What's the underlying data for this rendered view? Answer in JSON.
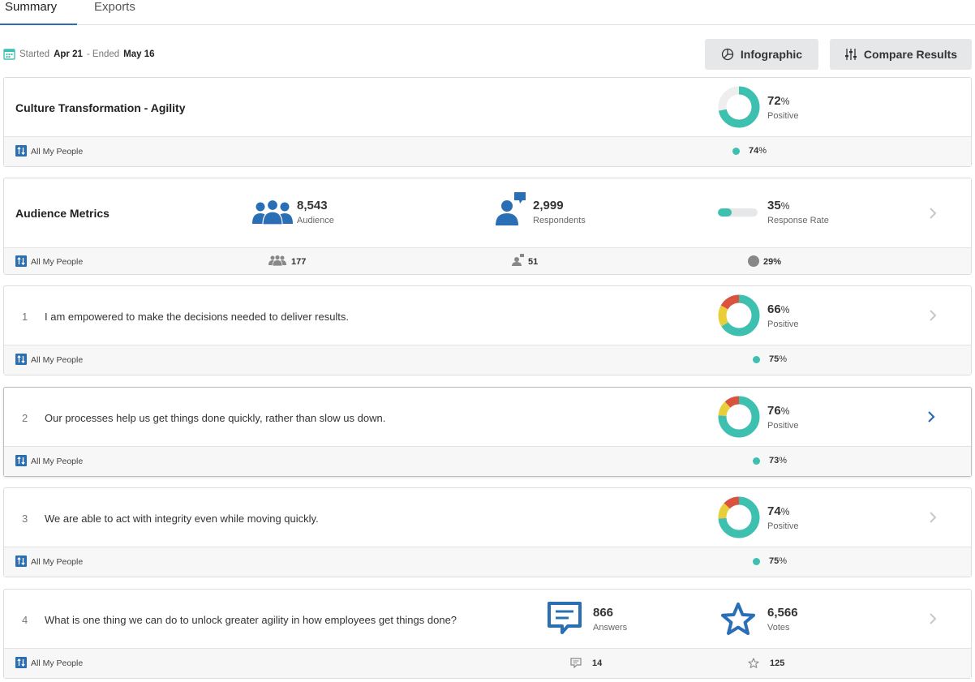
{
  "tabs": [
    {
      "label": "Summary",
      "active": true
    },
    {
      "label": "Exports",
      "active": false
    }
  ],
  "dates": {
    "started_prefix": "Started",
    "start": "Apr 21",
    "ended_prefix": "- Ended",
    "end": "May 16"
  },
  "buttons": {
    "infographic": "Infographic",
    "compare": "Compare Results"
  },
  "colors": {
    "positive": "#3ec0b0",
    "neutral": "#e8cf3a",
    "negative": "#d9533e",
    "accent": "#2a6fb6"
  },
  "group_label": "All My People",
  "overview": {
    "title": "Culture Transformation - Agility",
    "pct": "72",
    "pct_label": "Positive",
    "footer_pct": "74",
    "breakdown": {
      "positive": 72,
      "neutral": 0,
      "negative": 0
    }
  },
  "audience": {
    "title": "Audience Metrics",
    "audience_count": "8,543",
    "audience_label": "Audience",
    "respondents_count": "2,999",
    "respondents_label": "Respondents",
    "rate_pct": "35",
    "rate_label": "Response Rate",
    "rate_value": 35,
    "footer_audience": "177",
    "footer_respondents": "51",
    "footer_rate": "29%"
  },
  "questions": [
    {
      "num": "1",
      "text": "I am empowered to make the decisions needed to deliver results.",
      "pct": "66",
      "pct_label": "Positive",
      "footer_pct": "75",
      "breakdown": {
        "positive": 66,
        "neutral": 17,
        "negative": 17
      }
    },
    {
      "num": "2",
      "text": "Our processes help us get things done quickly, rather than slow us down.",
      "pct": "76",
      "pct_label": "Positive",
      "footer_pct": "73",
      "breakdown": {
        "positive": 76,
        "neutral": 12,
        "negative": 12
      }
    },
    {
      "num": "3",
      "text": "We are able to act with integrity even while moving quickly.",
      "pct": "74",
      "pct_label": "Positive",
      "footer_pct": "75",
      "breakdown": {
        "positive": 74,
        "neutral": 13,
        "negative": 13
      }
    }
  ],
  "open_question": {
    "num": "4",
    "text": "What is one thing we can do to unlock greater agility in how employees get things done?",
    "answers": "866",
    "answers_label": "Answers",
    "votes": "6,566",
    "votes_label": "Votes",
    "footer_answers": "14",
    "footer_votes": "125"
  },
  "icons": [
    "calendar-icon",
    "pie-chart-icon",
    "sliders-icon",
    "group-sort-icon",
    "audience-icon",
    "respondent-icon",
    "chevron-right-icon",
    "comment-icon",
    "star-icon"
  ]
}
